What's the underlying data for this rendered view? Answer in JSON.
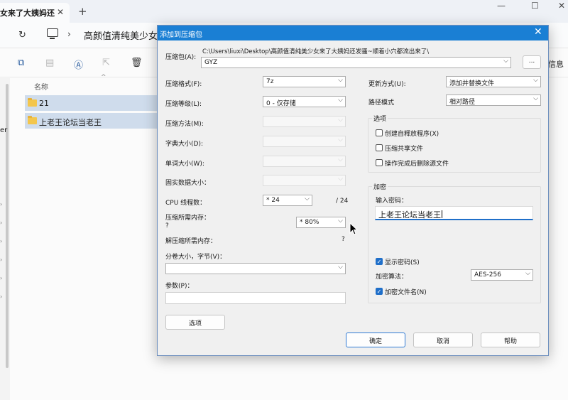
{
  "explorer": {
    "tab_title": "女来了大姨妈还",
    "tab_close": "✕",
    "tab_new": "+",
    "window_minimize": "—",
    "window_maximize": "☐",
    "window_close": "✕",
    "refresh_icon": "↻",
    "path_chevron": "›",
    "address_path": "高颜值清纯美少女来",
    "info_label": "信息",
    "column_name": "名称",
    "sort_indicator": "^",
    "nav_label_fragment": "er",
    "files": [
      {
        "name": "21"
      },
      {
        "name": "上老王论坛当老王"
      }
    ]
  },
  "dialog": {
    "title": "添加到压缩包",
    "close_glyph": "✕",
    "archive_label": "压缩包(A):",
    "archive_path": "C:\\Users\\liuxi\\Desktop\\高颜值清纯美少女来了大姨妈还发骚~顺着小穴都流出来了\\",
    "archive_name": "GYZ",
    "browse_button": "...",
    "left": {
      "format_label": "压缩格式(F):",
      "format_value": "7z",
      "level_label": "压缩等级(L):",
      "level_value": "0 - 仅存储",
      "method_label": "压缩方法(M):",
      "dict_label": "字典大小(D):",
      "word_label": "单词大小(W):",
      "solid_label": "固实数据大小：",
      "cpu_label": "CPU 线程数：",
      "cpu_value": "* 24",
      "cpu_total": "/ 24",
      "mem_compress_label": "压缩所需内存：",
      "mem_compress_q": "?",
      "mem_value": "* 80%",
      "mem_decompress_label": "解压缩所需内存：",
      "mem_decompress_q": "?",
      "volume_label": "分卷大小，字节(V)：",
      "volume_value": "",
      "params_label": "参数(P)：",
      "params_value": "",
      "options_button": "选项"
    },
    "right": {
      "update_label": "更新方式(U):",
      "update_value": "添加并替换文件",
      "path_mode_label": "路径模式",
      "path_mode_value": "相对路径",
      "options_group": "选项",
      "opt_sfx": "创建自释放程序(X)",
      "opt_shared": "压缩共享文件",
      "opt_delete": "操作完成后删除源文件",
      "encrypt_group": "加密",
      "password_label": "输入密码：",
      "password_value": "上老王论坛当老王",
      "show_password": "显示密码(S)",
      "method_label": "加密算法：",
      "method_value": "AES-256",
      "encrypt_names": "加密文件名(N)"
    },
    "buttons": {
      "ok": "确定",
      "cancel": "取消",
      "help": "帮助"
    },
    "check_mark": "✓",
    "dropdown_chevron": "⌵"
  }
}
